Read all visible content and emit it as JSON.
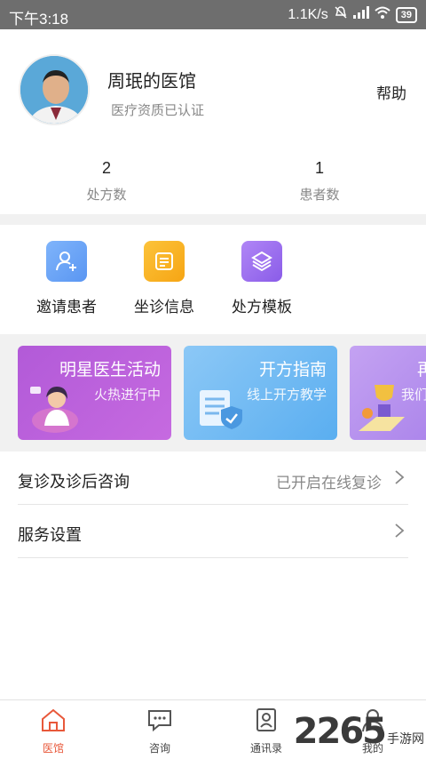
{
  "status_bar": {
    "time": "下午3:18",
    "network_speed": "1.1K/s",
    "battery": "39"
  },
  "profile": {
    "clinic_name": "周珉的医馆",
    "certification": "医疗资质已认证",
    "help_label": "帮助",
    "stats": [
      {
        "value": "2",
        "label": "处方数"
      },
      {
        "value": "1",
        "label": "患者数"
      }
    ]
  },
  "quick_actions": [
    {
      "label": "邀请患者",
      "icon": "user-add-icon",
      "color": "#6aa6f8"
    },
    {
      "label": "坐诊信息",
      "icon": "document-icon",
      "color": "#f8b020"
    },
    {
      "label": "处方模板",
      "icon": "layers-icon",
      "color": "#9a6af0"
    }
  ],
  "banners": [
    {
      "title": "明星医生活动",
      "subtitle": "火热进行中",
      "color": "#b45ad8"
    },
    {
      "title": "开方指南",
      "subtitle": "线上开方教学",
      "color": "#6fb8f0"
    },
    {
      "title": "再",
      "subtitle": "我们",
      "color": "#b088e8"
    }
  ],
  "settings_rows": [
    {
      "label": "复诊及诊后咨询",
      "value": "已开启在线复诊"
    },
    {
      "label": "服务设置",
      "value": ""
    }
  ],
  "tabbar": [
    {
      "label": "医馆",
      "icon": "clinic-icon",
      "active": true
    },
    {
      "label": "咨询",
      "icon": "chat-icon",
      "active": false
    },
    {
      "label": "通讯录",
      "icon": "contacts-icon",
      "active": false
    },
    {
      "label": "我的",
      "icon": "user-icon",
      "active": false
    }
  ],
  "watermark": {
    "number": "2265",
    "site": "手游网"
  },
  "colors": {
    "accent": "#e8583a",
    "status_bar": "#6e6e6e",
    "band": "#f1f1f1"
  }
}
